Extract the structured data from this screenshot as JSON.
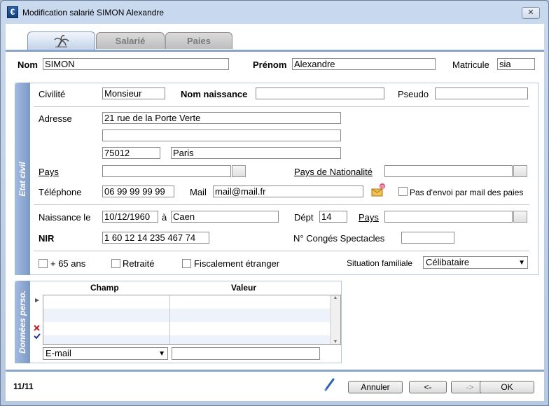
{
  "window": {
    "title": "Modification salarié SIMON Alexandre",
    "app_icon_glyph": "€",
    "close_glyph": "✕"
  },
  "tabs": [
    {
      "label": "",
      "icon": "palm-tree-icon",
      "active": true
    },
    {
      "label": "Salarié",
      "active": false
    },
    {
      "label": "Paies",
      "active": false
    }
  ],
  "identity": {
    "nom_label": "Nom",
    "nom_value": "SIMON",
    "prenom_label": "Prénom",
    "prenom_value": "Alexandre",
    "matricule_label": "Matricule",
    "matricule_value": "sia"
  },
  "etat_civil": {
    "section_title": "Etat civil",
    "civilite_label": "Civilité",
    "civilite_value": "Monsieur",
    "nom_naissance_label": "Nom naissance",
    "nom_naissance_value": "",
    "pseudo_label": "Pseudo",
    "pseudo_value": "",
    "adresse_label": "Adresse",
    "adresse_line1": "21 rue de la Porte Verte",
    "adresse_line2": "",
    "code_postal": "75012",
    "ville": "Paris",
    "pays_label": "Pays",
    "pays_value": "",
    "pays_nationalite_label": "Pays de Nationalité",
    "pays_nationalite_value": "",
    "telephone_label": "Téléphone",
    "telephone_value": "06 99 99 99 99",
    "mail_label": "Mail",
    "mail_value": "mail@mail.fr",
    "pas_envoi_label": "Pas d'envoi par mail des paies",
    "naissance_label": "Naissance le",
    "naissance_value": "10/12/1960",
    "a_label": "à",
    "lieu_naissance_value": "Caen",
    "dept_label": "Dépt",
    "dept_value": "14",
    "pays_naissance_label": "Pays",
    "pays_naissance_value": "",
    "nir_label": "NIR",
    "nir_value": "1 60 12 14 235 467 74",
    "conges_label": "N° Congés Spectacles",
    "conges_value": "",
    "plus65_label": "+ 65 ans",
    "retraite_label": "Retraité",
    "fiscal_label": "Fiscalement étranger",
    "situation_label": "Situation familiale",
    "situation_value": "Célibataire"
  },
  "donnees_perso": {
    "section_title": "Données perso.",
    "col_champ": "Champ",
    "col_valeur": "Valeur",
    "field_select_value": "E-mail",
    "field_value": ""
  },
  "footer": {
    "record_counter": "11/11",
    "annuler_label": "Annuler",
    "prev_label": "<-",
    "next_label": "->",
    "ok_label": "OK"
  }
}
